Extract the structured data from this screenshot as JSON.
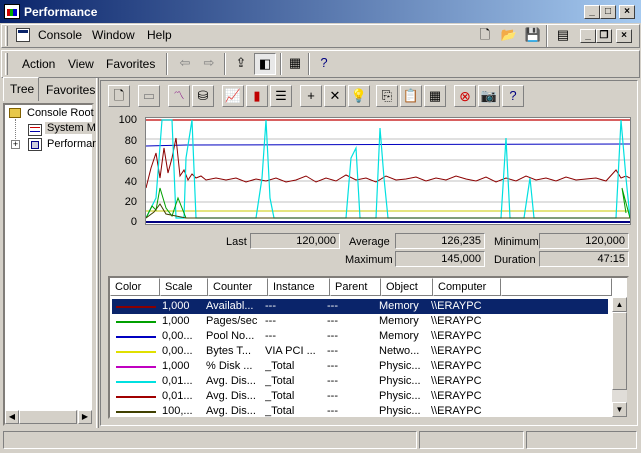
{
  "window": {
    "title": "Performance"
  },
  "menubar": {
    "console": "Console",
    "window": "Window",
    "help": "Help"
  },
  "toolbar": {
    "action": "Action",
    "view": "View",
    "favorites": "Favorites"
  },
  "tabs": {
    "tree": "Tree",
    "favorites": "Favorites"
  },
  "tree": {
    "root": "Console Root",
    "system_monitor": "System M",
    "performance_logs": "Performar"
  },
  "graph": {
    "y_ticks": [
      "100",
      "80",
      "60",
      "40",
      "20",
      "0"
    ]
  },
  "stats": {
    "last_label": "Last",
    "last_value": "120,000",
    "average_label": "Average",
    "average_value": "126,235",
    "minimum_label": "Minimum",
    "minimum_value": "120,000",
    "maximum_label": "Maximum",
    "maximum_value": "145,000",
    "duration_label": "Duration",
    "duration_value": "47:15"
  },
  "list": {
    "headers": [
      "Color",
      "Scale",
      "Counter",
      "Instance",
      "Parent",
      "Object",
      "Computer"
    ],
    "rows": [
      {
        "color": "#8b0000",
        "scale": "1,000",
        "counter": "Availabl...",
        "instance": "---",
        "parent": "---",
        "object": "Memory",
        "computer": "\\\\ERAYPC"
      },
      {
        "color": "#00a000",
        "scale": "1,000",
        "counter": "Pages/sec",
        "instance": "---",
        "parent": "---",
        "object": "Memory",
        "computer": "\\\\ERAYPC"
      },
      {
        "color": "#0000c0",
        "scale": "0,00...",
        "counter": "Pool No...",
        "instance": "---",
        "parent": "---",
        "object": "Memory",
        "computer": "\\\\ERAYPC"
      },
      {
        "color": "#e0e000",
        "scale": "0,00...",
        "counter": "Bytes T...",
        "instance": "VIA PCI ...",
        "parent": "---",
        "object": "Netwo...",
        "computer": "\\\\ERAYPC"
      },
      {
        "color": "#c000c0",
        "scale": "1,000",
        "counter": "% Disk ...",
        "instance": "_Total",
        "parent": "---",
        "object": "Physic...",
        "computer": "\\\\ERAYPC"
      },
      {
        "color": "#00e0e0",
        "scale": "0,01...",
        "counter": "Avg. Dis...",
        "instance": "_Total",
        "parent": "---",
        "object": "Physic...",
        "computer": "\\\\ERAYPC"
      },
      {
        "color": "#a00000",
        "scale": "0,01...",
        "counter": "Avg. Dis...",
        "instance": "_Total",
        "parent": "---",
        "object": "Physic...",
        "computer": "\\\\ERAYPC"
      },
      {
        "color": "#404000",
        "scale": "100,...",
        "counter": "Avg. Dis...",
        "instance": "_Total",
        "parent": "---",
        "object": "Physic...",
        "computer": "\\\\ERAYPC"
      }
    ]
  },
  "colors": {
    "title_bar": "#0a246a",
    "selection": "#0a246a",
    "face": "#d4d0c8"
  }
}
